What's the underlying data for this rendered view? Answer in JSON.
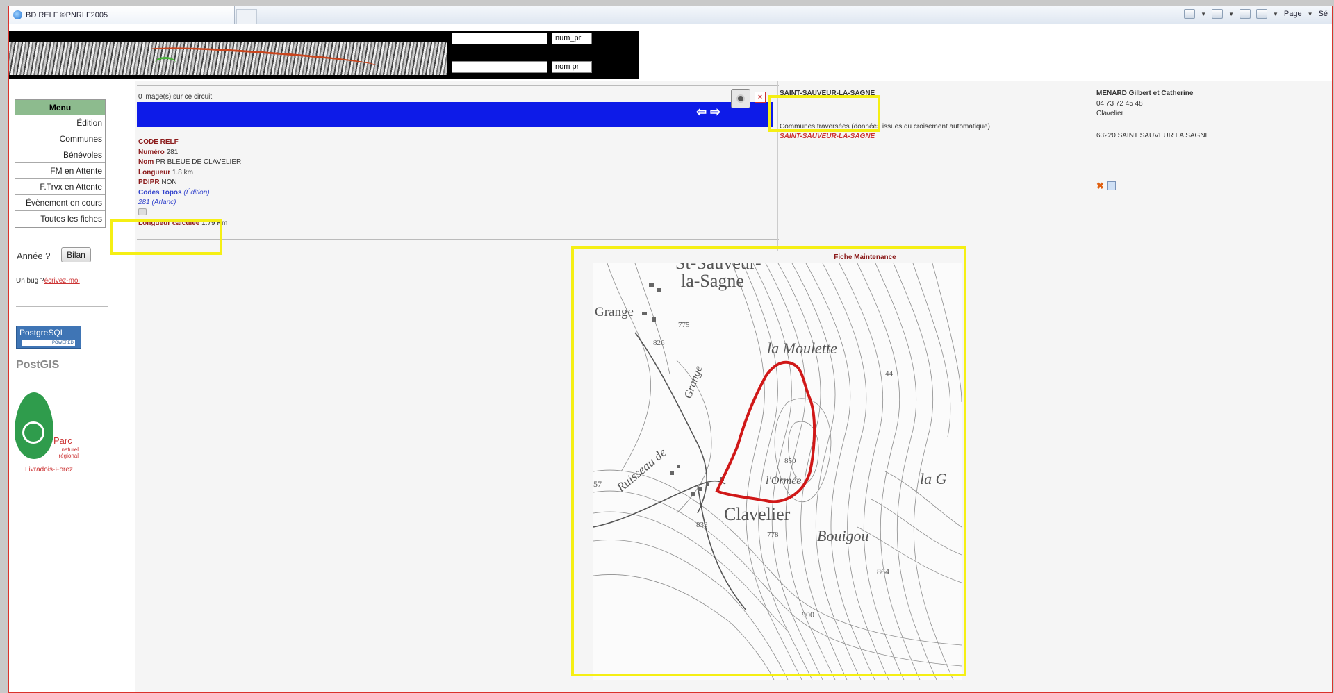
{
  "browser": {
    "tab_title": "BD RELF ©PNRLF2005",
    "page_menu": "Page",
    "safety_menu": "Sé"
  },
  "header": {
    "num_pr_label": "num_pr",
    "nom_pr_label": "nom pr",
    "num_pr_value": "",
    "nom_pr_value": ""
  },
  "menu": {
    "title": "Menu",
    "items": [
      "Édition",
      "Communes",
      "Bénévoles",
      "FM en Attente",
      "F.Trvx en Attente",
      "Évènement en cours",
      "Toutes les fiches"
    ],
    "annee_label": "Année ?",
    "bilan_label": "Bilan",
    "bug_text": "Un bug ?",
    "bug_link": "écrivez-moi"
  },
  "logos": {
    "postgresql": "PostgreSQL",
    "postgresql_powered": "POWERED",
    "postgis": "PostGIS",
    "park_name": "Parc",
    "park_sub": "naturel régional",
    "park_region": "Livradois-Forez"
  },
  "circuit": {
    "image_count": "0 image(s) sur ce circuit",
    "code_relf_label": "CODE RELF",
    "numero_label": "Numéro",
    "numero_value": "281",
    "nom_label": "Nom",
    "nom_value": "PR BLEUE DE CLAVELIER",
    "longueur_label": "Longueur",
    "longueur_value": "1.8 km",
    "pdipr_label": "PDIPR",
    "pdipr_value": "NON",
    "codes_topos_label": "Codes Topos",
    "codes_topos_edit": "(Édition)",
    "topo_entry": "281 (Arlanc)",
    "longueur_calc_label": "Longueur calculée",
    "longueur_calc_value": "1.79 Km"
  },
  "commune": {
    "title": "SAINT-SAUVEUR-LA-SAGNE",
    "traversees_text": "Communes traversées (données issues du croisement automatique)",
    "traversees_value": "SAINT-SAUVEUR-LA-SAGNE"
  },
  "contact": {
    "name": "MENARD Gilbert et Catherine",
    "phone": "04 73 72 45 48",
    "place": "Clavelier",
    "address": "63220 SAINT SAUVEUR LA SAGNE"
  },
  "map": {
    "title": "Fiche Maintenance",
    "labels": {
      "town_top": "St-Sauveur-",
      "town_top2": "la-Sagne",
      "grange": "Grange",
      "grange2": "Grange",
      "moulette": "la Moulette",
      "ruisseau": "Ruisseau de",
      "clavelier": "Clavelier",
      "bouigou": "Bouigou",
      "la_g": "la G",
      "ormee": "l'Ormée",
      "e826": "826",
      "e775": "775",
      "e850": "850",
      "e839": "839",
      "e778": "778",
      "e864": "864",
      "e900": "900",
      "e57": "57",
      "e44": "44"
    }
  },
  "colors": {
    "highlight": "#f5ef14",
    "bluebar": "#0d1be8",
    "menu_header": "#8dbb8e",
    "label_red": "#8b1a1a",
    "trail_red": "#d01818"
  }
}
